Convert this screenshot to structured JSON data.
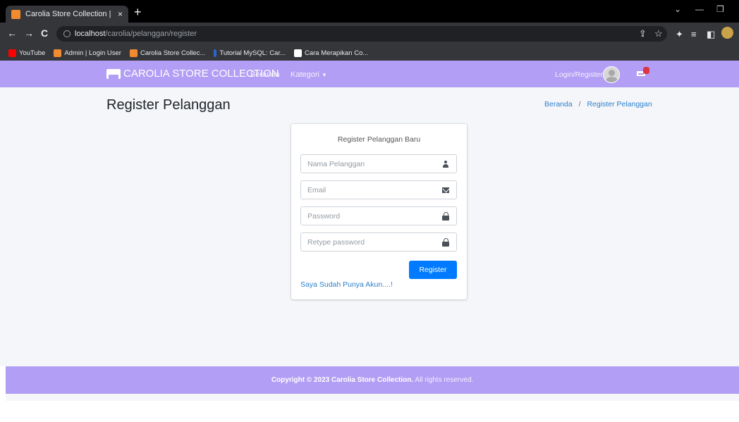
{
  "browser": {
    "tab_title": "Carolia Store Collection | Registe",
    "tab_close": "×",
    "new_tab": "+",
    "url_host": "localhost",
    "url_path": "/carolia/pelanggan/register",
    "nav": {
      "back": "←",
      "forward": "→",
      "reload": "C"
    },
    "window": {
      "minimize": "—",
      "chevron": "⌄",
      "restore": "❐"
    },
    "extensions": {
      "share": "⇪",
      "star": "☆",
      "puzzle": "✦",
      "menu": "≡",
      "sidepanel": "◧"
    },
    "bookmarks": [
      {
        "label": "YouTube",
        "color": "#ff0000"
      },
      {
        "label": "Admin | Login User",
        "color": "#f28b30"
      },
      {
        "label": "Carolia Store Collec...",
        "color": "#f28b30"
      },
      {
        "label": "Tutorial MySQL: Car...",
        "color": "#2a66c9"
      },
      {
        "label": "Cara Merapikan Co...",
        "color": "#ffffff"
      }
    ]
  },
  "navbar": {
    "brand": "CAROLIA STORE COLLECTION",
    "links": [
      "Beranda",
      "Kategori"
    ],
    "login": "Login/Register",
    "cart_count": "",
    "bg_color": "#b29ef4"
  },
  "page": {
    "title": "Register Pelanggan",
    "breadcrumb": [
      "Beranda",
      "Register Pelanggan"
    ],
    "breadcrumb_sep": "/"
  },
  "form": {
    "heading": "Register Pelanggan Baru",
    "fields": [
      {
        "placeholder": "Nama Pelanggan",
        "icon": "user-icon"
      },
      {
        "placeholder": "Email",
        "icon": "envelope-icon"
      },
      {
        "placeholder": "Password",
        "icon": "lock-icon"
      },
      {
        "placeholder": "Retype password",
        "icon": "lock-icon"
      }
    ],
    "submit_label": "Register",
    "login_link": "Saya Sudah Punya Akun....!"
  },
  "footer": {
    "prefix": "Copyright © 2023 Carolia Store Collection.",
    "suffix": " All rights reserved."
  }
}
